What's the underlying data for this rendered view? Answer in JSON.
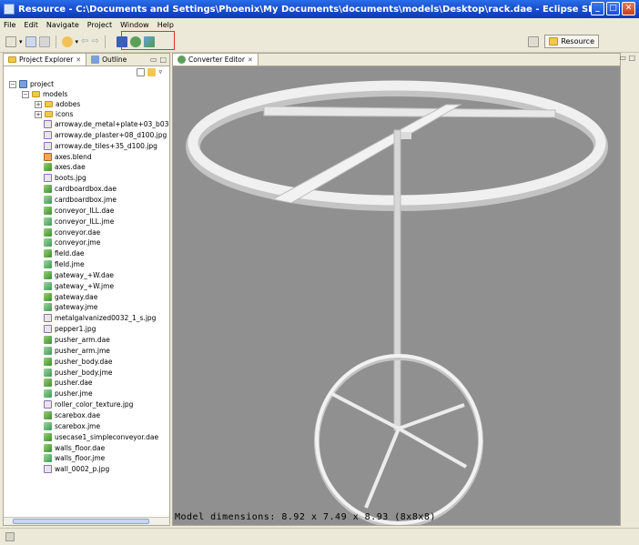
{
  "window": {
    "title": "Resource - C:\\Documents and Settings\\Phoenix\\My Documents\\documents\\models\\Desktop\\rack.dae - Eclipse SDK"
  },
  "menu": [
    "File",
    "Edit",
    "Navigate",
    "Project",
    "Window",
    "Help"
  ],
  "perspective": {
    "label": "Resource"
  },
  "left_pane": {
    "tabs": [
      {
        "label": "Project Explorer",
        "close": "✕"
      },
      {
        "label": "Outline"
      }
    ]
  },
  "tree": {
    "root": "project",
    "models_folder": "models",
    "folders": [
      "adobes",
      "icons"
    ],
    "files": [
      {
        "name": "arroway.de_metal+plate+03_b030.jpg",
        "type": "img"
      },
      {
        "name": "arroway.de_plaster+08_d100.jpg",
        "type": "img"
      },
      {
        "name": "arroway.de_tiles+35_d100.jpg",
        "type": "img"
      },
      {
        "name": "axes.blend",
        "type": "blend"
      },
      {
        "name": "axes.dae",
        "type": "dae"
      },
      {
        "name": "boots.jpg",
        "type": "img"
      },
      {
        "name": "cardboardbox.dae",
        "type": "dae"
      },
      {
        "name": "cardboardbox.jme",
        "type": "jme"
      },
      {
        "name": "conveyor_ILL.dae",
        "type": "dae"
      },
      {
        "name": "conveyor_ILL.jme",
        "type": "jme"
      },
      {
        "name": "conveyor.dae",
        "type": "dae"
      },
      {
        "name": "conveyor.jme",
        "type": "jme"
      },
      {
        "name": "field.dae",
        "type": "dae"
      },
      {
        "name": "field.jme",
        "type": "jme"
      },
      {
        "name": "gateway_+W.dae",
        "type": "dae"
      },
      {
        "name": "gateway_+W.jme",
        "type": "jme"
      },
      {
        "name": "gateway.dae",
        "type": "dae"
      },
      {
        "name": "gateway.jme",
        "type": "jme"
      },
      {
        "name": "metalgalvanized0032_1_s.jpg",
        "type": "img"
      },
      {
        "name": "pepper1.jpg",
        "type": "img"
      },
      {
        "name": "pusher_arm.dae",
        "type": "dae"
      },
      {
        "name": "pusher_arm.jme",
        "type": "jme"
      },
      {
        "name": "pusher_body.dae",
        "type": "dae"
      },
      {
        "name": "pusher_body.jme",
        "type": "jme"
      },
      {
        "name": "pusher.dae",
        "type": "dae"
      },
      {
        "name": "pusher.jme",
        "type": "jme"
      },
      {
        "name": "roller_color_texture.jpg",
        "type": "img"
      },
      {
        "name": "scarebox.dae",
        "type": "dae"
      },
      {
        "name": "scarebox.jme",
        "type": "jme"
      },
      {
        "name": "usecase1_simpleconveyor.dae",
        "type": "dae"
      },
      {
        "name": "walls_floor.dae",
        "type": "dae"
      },
      {
        "name": "walls_floor.jme",
        "type": "jme"
      },
      {
        "name": "wall_0002_p.jpg",
        "type": "img"
      }
    ]
  },
  "editor": {
    "tab": {
      "label": "Converter Editor",
      "close": "✕"
    },
    "model_dimensions": "Model dimensions: 8.92 x 7.49 x 8.93  (8x8x8)"
  },
  "colors": {
    "titlebar": "#1a50d0",
    "viewport_bg": "#909090",
    "model_stroke": "#f2f2f2",
    "model_shade": "#b8b8b8",
    "highlight": "#e03030"
  }
}
